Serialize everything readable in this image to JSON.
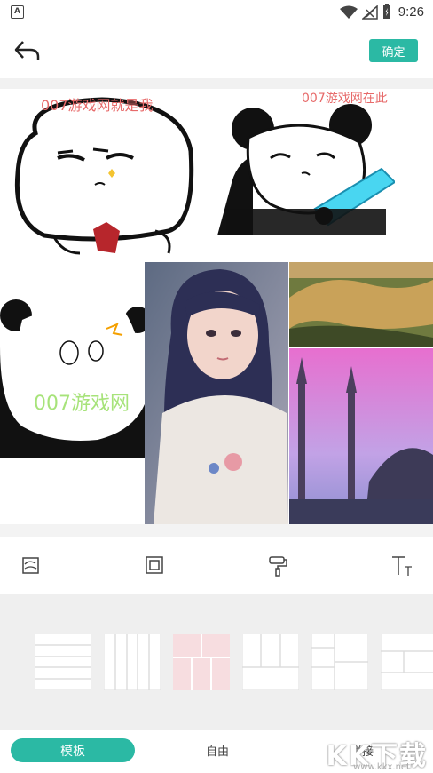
{
  "status_bar": {
    "time": "9:26",
    "app_badge": "A"
  },
  "header": {
    "confirm_label": "确定"
  },
  "canvas": {
    "watermark_1": "007游戏网就是我",
    "watermark_2": "007游戏网在此",
    "watermark_3": "007游戏网"
  },
  "tools": [
    "background-icon",
    "frame-icon",
    "paint-roller-icon",
    "text-icon"
  ],
  "bottom_tabs": {
    "template": "模板",
    "free": "自由",
    "splice": "拼接"
  },
  "brand": {
    "logo": "KK下载",
    "url": "www.kkx.net"
  },
  "colors": {
    "accent": "#2bb9a4",
    "watermark": "#e76a6a",
    "selected_template": "#f7dde0"
  }
}
